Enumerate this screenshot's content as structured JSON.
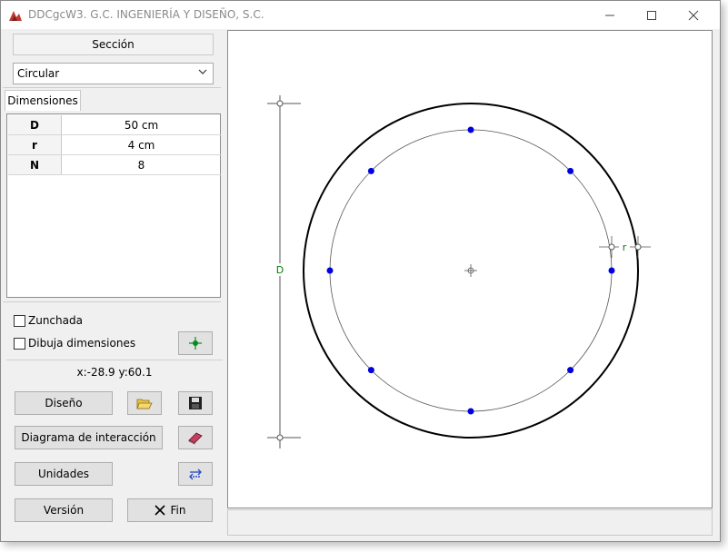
{
  "window": {
    "title": "DDCgcW3. G.C. INGENIERÍA Y DISEÑO, S.C."
  },
  "left": {
    "section_label": "Sección",
    "section_type": "Circular",
    "tab_label": "Dimensiones",
    "dimensions": [
      {
        "key": "D",
        "value": "50 cm"
      },
      {
        "key": "r",
        "value": "4 cm"
      },
      {
        "key": "N",
        "value": "8"
      }
    ],
    "zunchada_label": "Zunchada",
    "zunchada_checked": false,
    "dibuja_label": "Dibuja dimensiones",
    "dibuja_checked": false,
    "coords": "x:-28.9 y:60.1",
    "btn_diseno": "Diseño",
    "btn_diagrama": "Diagrama de interacción",
    "btn_unidades": "Unidades",
    "btn_version": "Versión",
    "btn_fin": "Fin"
  },
  "drawing": {
    "dim_D_label": "D",
    "dim_r_label": "r",
    "bar_count": 8,
    "bar_color": "#0000dd",
    "dim_color": "#008000"
  }
}
